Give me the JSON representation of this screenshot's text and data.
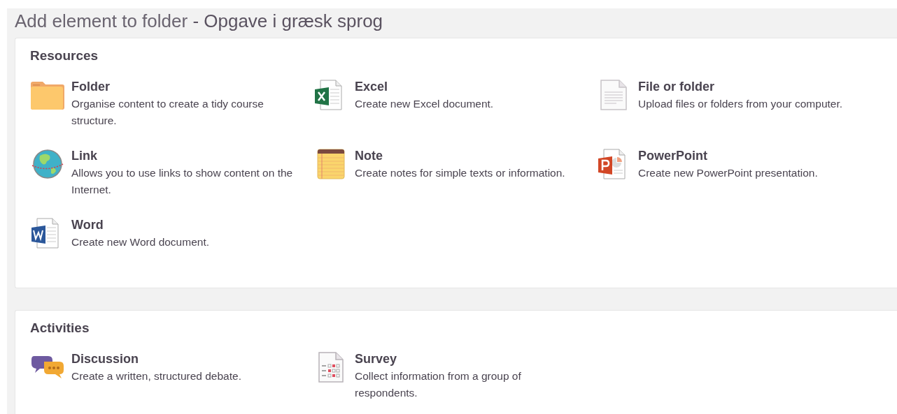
{
  "title": {
    "main": "Add element to folder",
    "separator": " - ",
    "folder": "Opgave i græsk sprog"
  },
  "sections": [
    {
      "heading": "Resources",
      "items": [
        {
          "kind": "folder",
          "name": "Folder",
          "description": "Organise content to create a tidy course structure."
        },
        {
          "kind": "excel",
          "name": "Excel",
          "description": "Create new Excel document."
        },
        {
          "kind": "file",
          "name": "File or folder",
          "description": "Upload files or folders from your computer."
        },
        {
          "kind": "link",
          "name": "Link",
          "description": "Allows you to use links to show content on the Internet."
        },
        {
          "kind": "note",
          "name": "Note",
          "description": "Create notes for simple texts or information."
        },
        {
          "kind": "powerpoint",
          "name": "PowerPoint",
          "description": "Create new PowerPoint presentation."
        },
        {
          "kind": "word",
          "name": "Word",
          "description": "Create new Word document."
        }
      ]
    },
    {
      "heading": "Activities",
      "items": [
        {
          "kind": "discussion",
          "name": "Discussion",
          "description": "Create a written, structured debate."
        },
        {
          "kind": "survey",
          "name": "Survey",
          "description": "Collect information from a group of respondents."
        }
      ]
    }
  ]
}
